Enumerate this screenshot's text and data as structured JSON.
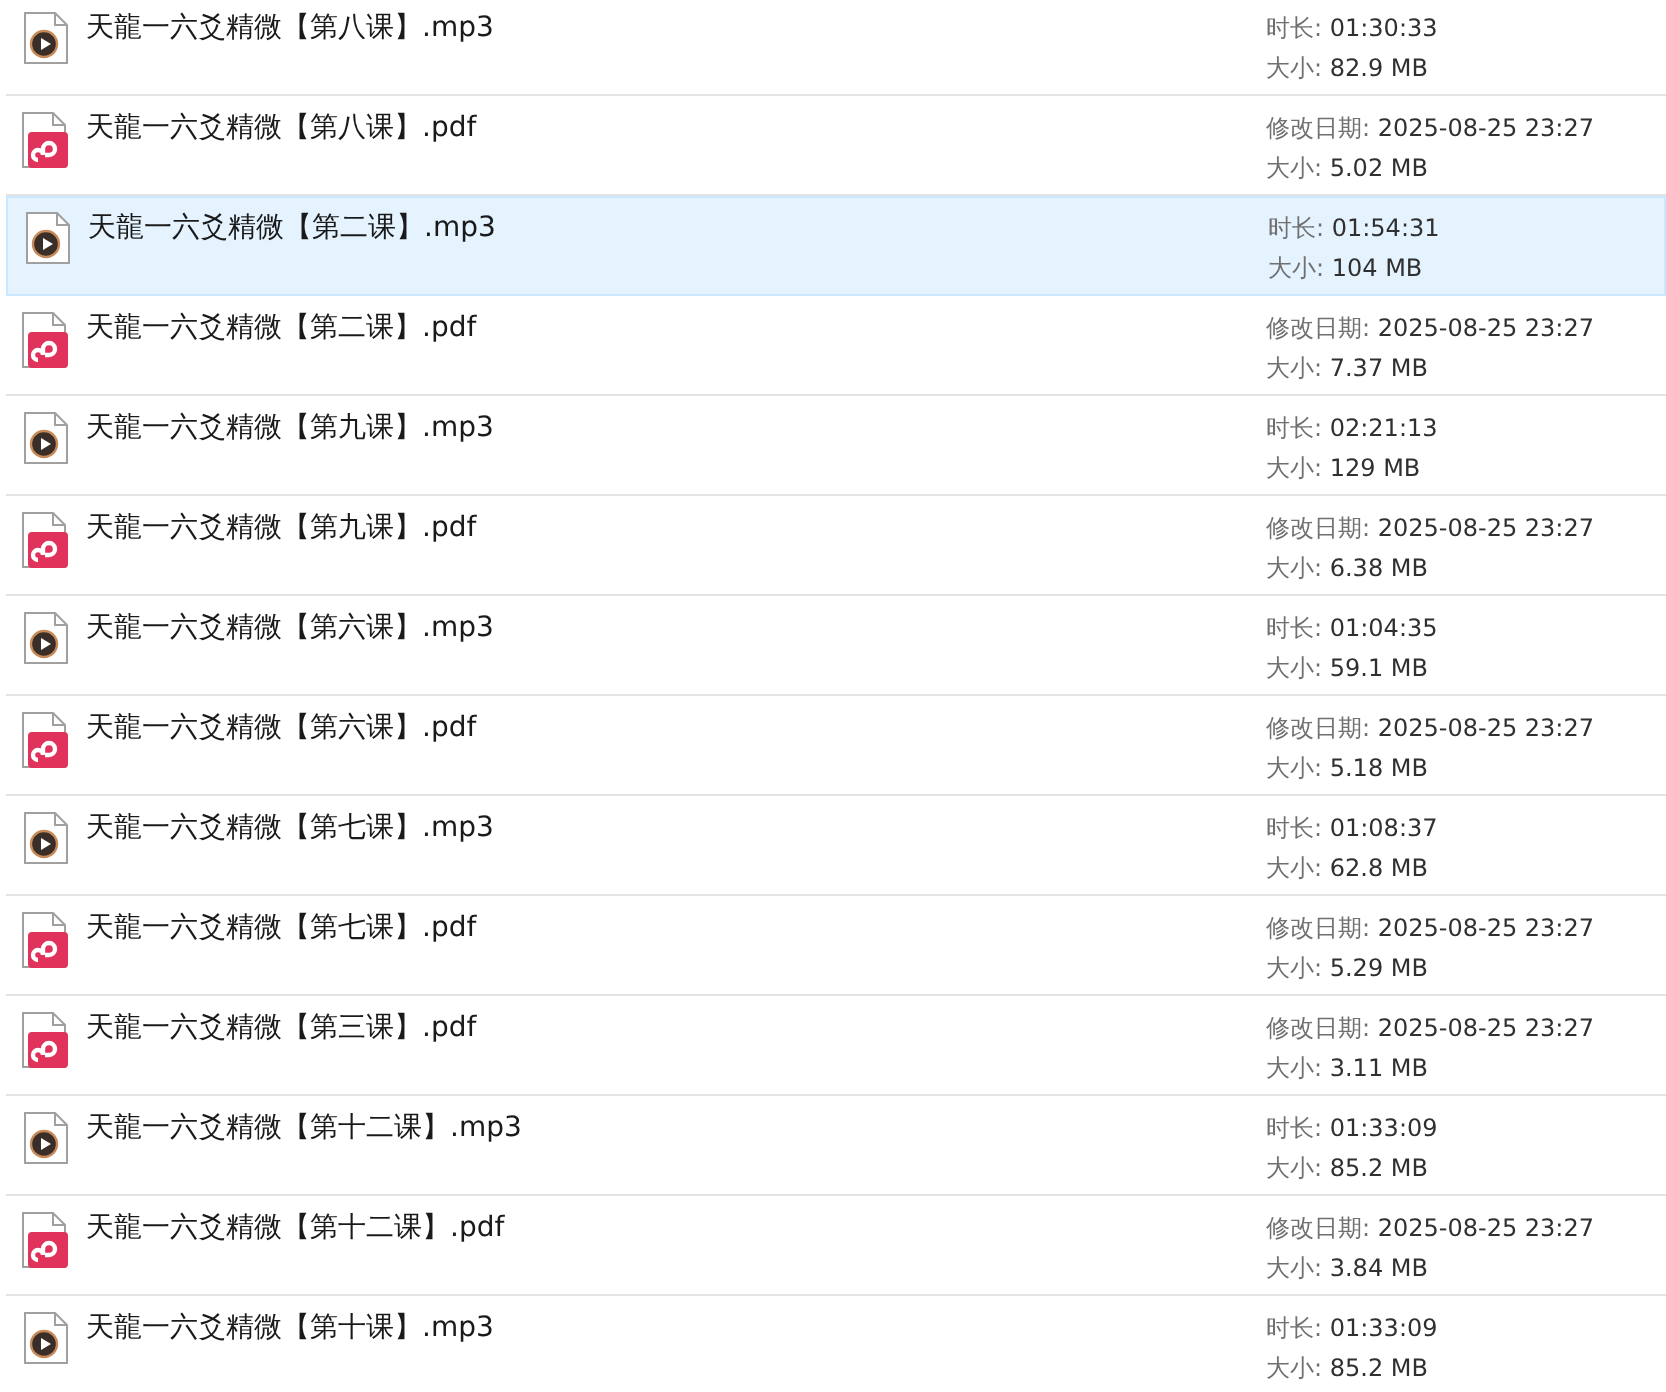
{
  "files": [
    {
      "kind": "audio",
      "name": "天龍一六爻精微【第八课】.mp3",
      "selected": false,
      "details": [
        {
          "label": "时长:",
          "value": "01:30:33"
        },
        {
          "label": "大小:",
          "value": "82.9 MB"
        }
      ]
    },
    {
      "kind": "pdf",
      "name": "天龍一六爻精微【第八课】.pdf",
      "selected": false,
      "details": [
        {
          "label": "修改日期:",
          "value": "2025-08-25 23:27"
        },
        {
          "label": "大小:",
          "value": "5.02 MB"
        }
      ]
    },
    {
      "kind": "audio",
      "name": "天龍一六爻精微【第二课】.mp3",
      "selected": true,
      "details": [
        {
          "label": "时长:",
          "value": "01:54:31"
        },
        {
          "label": "大小:",
          "value": "104 MB"
        }
      ]
    },
    {
      "kind": "pdf",
      "name": "天龍一六爻精微【第二课】.pdf",
      "selected": false,
      "details": [
        {
          "label": "修改日期:",
          "value": "2025-08-25 23:27"
        },
        {
          "label": "大小:",
          "value": "7.37 MB"
        }
      ]
    },
    {
      "kind": "audio",
      "name": "天龍一六爻精微【第九课】.mp3",
      "selected": false,
      "details": [
        {
          "label": "时长:",
          "value": "02:21:13"
        },
        {
          "label": "大小:",
          "value": "129 MB"
        }
      ]
    },
    {
      "kind": "pdf",
      "name": "天龍一六爻精微【第九课】.pdf",
      "selected": false,
      "details": [
        {
          "label": "修改日期:",
          "value": "2025-08-25 23:27"
        },
        {
          "label": "大小:",
          "value": "6.38 MB"
        }
      ]
    },
    {
      "kind": "audio",
      "name": "天龍一六爻精微【第六课】.mp3",
      "selected": false,
      "details": [
        {
          "label": "时长:",
          "value": "01:04:35"
        },
        {
          "label": "大小:",
          "value": "59.1 MB"
        }
      ]
    },
    {
      "kind": "pdf",
      "name": "天龍一六爻精微【第六课】.pdf",
      "selected": false,
      "details": [
        {
          "label": "修改日期:",
          "value": "2025-08-25 23:27"
        },
        {
          "label": "大小:",
          "value": "5.18 MB"
        }
      ]
    },
    {
      "kind": "audio",
      "name": "天龍一六爻精微【第七课】.mp3",
      "selected": false,
      "details": [
        {
          "label": "时长:",
          "value": "01:08:37"
        },
        {
          "label": "大小:",
          "value": "62.8 MB"
        }
      ]
    },
    {
      "kind": "pdf",
      "name": "天龍一六爻精微【第七课】.pdf",
      "selected": false,
      "details": [
        {
          "label": "修改日期:",
          "value": "2025-08-25 23:27"
        },
        {
          "label": "大小:",
          "value": "5.29 MB"
        }
      ]
    },
    {
      "kind": "pdf",
      "name": "天龍一六爻精微【第三课】.pdf",
      "selected": false,
      "details": [
        {
          "label": "修改日期:",
          "value": "2025-08-25 23:27"
        },
        {
          "label": "大小:",
          "value": "3.11 MB"
        }
      ]
    },
    {
      "kind": "audio",
      "name": "天龍一六爻精微【第十二课】.mp3",
      "selected": false,
      "details": [
        {
          "label": "时长:",
          "value": "01:33:09"
        },
        {
          "label": "大小:",
          "value": "85.2 MB"
        }
      ]
    },
    {
      "kind": "pdf",
      "name": "天龍一六爻精微【第十二课】.pdf",
      "selected": false,
      "details": [
        {
          "label": "修改日期:",
          "value": "2025-08-25 23:27"
        },
        {
          "label": "大小:",
          "value": "3.84 MB"
        }
      ]
    },
    {
      "kind": "audio",
      "name": "天龍一六爻精微【第十课】.mp3",
      "selected": false,
      "details": [
        {
          "label": "时长:",
          "value": "01:33:09"
        },
        {
          "label": "大小:",
          "value": "85.2 MB"
        }
      ]
    }
  ]
}
